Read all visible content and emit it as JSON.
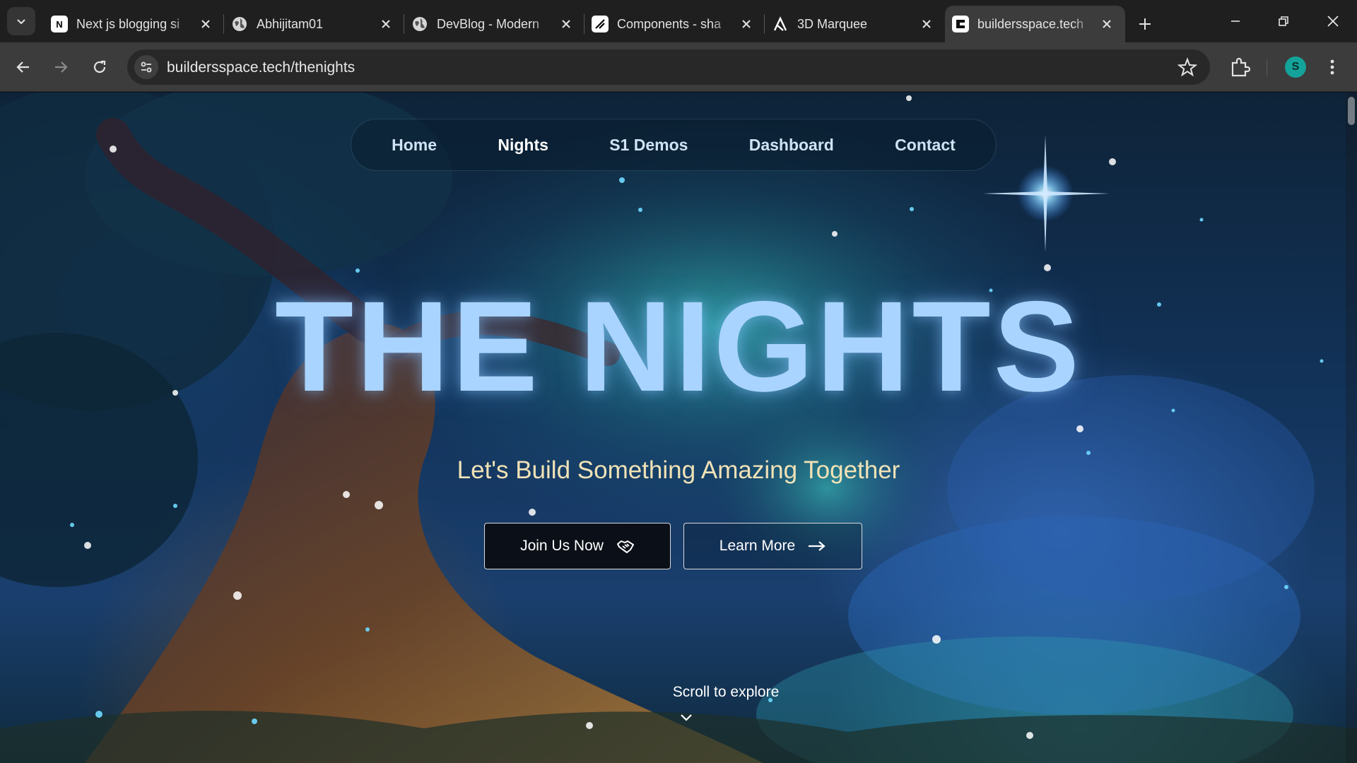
{
  "browser": {
    "tabs": [
      {
        "title": "Next js blogging si",
        "icon": "next-js-icon",
        "active": false
      },
      {
        "title": "Abhijitam01",
        "icon": "globe-icon",
        "active": false
      },
      {
        "title": "DevBlog - Modern",
        "icon": "globe-icon",
        "active": false
      },
      {
        "title": "Components - sha",
        "icon": "shadcn-slash-icon",
        "active": false
      },
      {
        "title": "3D Marquee",
        "icon": "aceternity-icon",
        "active": false
      },
      {
        "title": "buildersspace.tech",
        "icon": "builders-space-icon",
        "active": true
      }
    ],
    "address": "buildersspace.tech/thenights",
    "profile_initial": "S",
    "accent": "#14a39a"
  },
  "site": {
    "nav": [
      {
        "label": "Home"
      },
      {
        "label": "Nights"
      },
      {
        "label": "S1 Demos"
      },
      {
        "label": "Dashboard"
      },
      {
        "label": "Contact"
      }
    ],
    "hero_title": "THE NIGHTS",
    "subtitle": "Let's Build Something Amazing Together",
    "join_label": "Join Us Now",
    "learn_label": "Learn More",
    "scroll_hint": "Scroll to explore",
    "colors": {
      "title": "#a9d4ff",
      "subtitle": "#f0e2b6",
      "sky": "#12335a"
    }
  }
}
